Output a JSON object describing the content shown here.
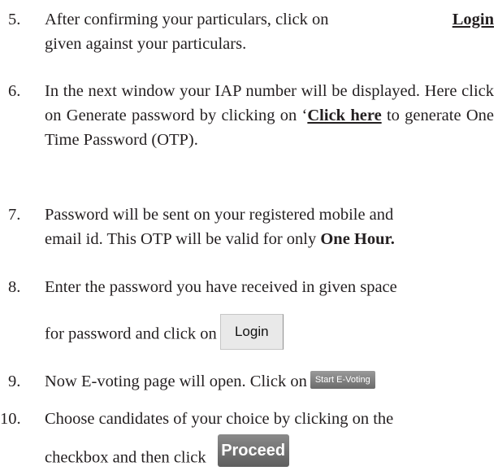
{
  "steps": [
    {
      "number": "5.",
      "line1": "After confirming your particulars, click on",
      "link": "Login",
      "line2": "given against your particulars."
    },
    {
      "number": "6.",
      "text_before": "In the next window your IAP number will be displayed. Here click on Generate password by clicking on ‘",
      "link": "Click here",
      "text_after": " to generate One Time Password (OTP)."
    },
    {
      "number": "7.",
      "line1": "Password will be sent on your registered mobile and",
      "line2_text": "email id. This OTP will be valid for only ",
      "line2_bold": "One Hour."
    },
    {
      "number": "8.",
      "line1": "Enter the password you have received in given space",
      "line2": "for password and click on",
      "button_label": "Login"
    },
    {
      "number": "9.",
      "text": "Now E-voting page will open. Click on",
      "button_label": "Start E-Voting"
    },
    {
      "number": "10.",
      "line1": "Choose candidates of your choice by clicking on the",
      "line2": "checkbox and then click",
      "button_label": "Proceed"
    }
  ]
}
